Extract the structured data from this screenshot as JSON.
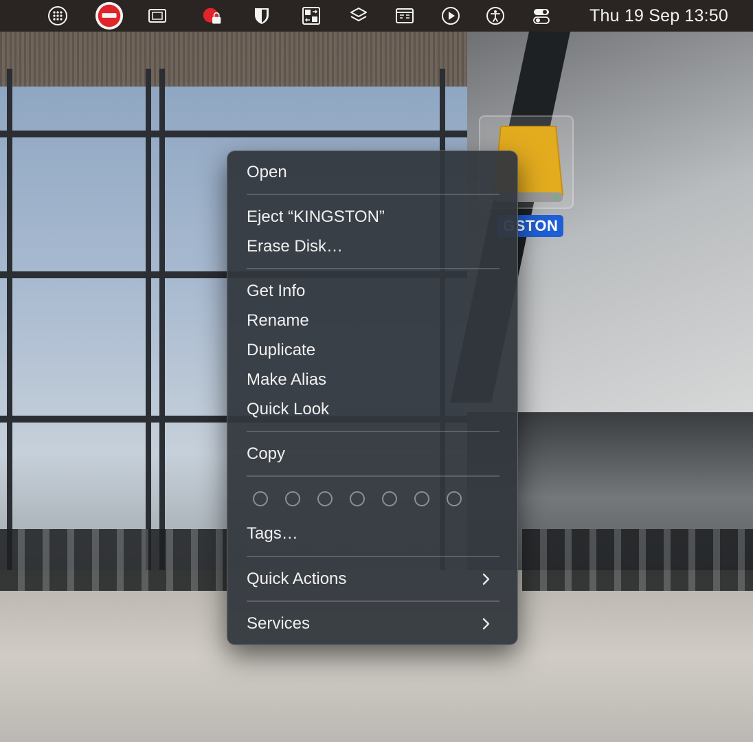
{
  "menubar": {
    "icons": [
      {
        "name": "launchpad-grid-icon"
      },
      {
        "name": "do-not-disturb-icon"
      },
      {
        "name": "window-manager-icon"
      },
      {
        "name": "privacy-lock-icon"
      },
      {
        "name": "shield-icon"
      },
      {
        "name": "screens-switch-icon"
      },
      {
        "name": "layers-icon"
      },
      {
        "name": "keyboard-shortcuts-icon"
      },
      {
        "name": "play-icon"
      },
      {
        "name": "accessibility-icon"
      },
      {
        "name": "control-center-icon"
      }
    ],
    "clock": "Thu 19 Sep  13:50"
  },
  "desktop": {
    "drive": {
      "label": "KINGSTON",
      "visible_label": "GSTON",
      "color": "#e3ac1f"
    }
  },
  "context_menu": {
    "items": {
      "open": "Open",
      "eject": "Eject “KINGSTON”",
      "erase": "Erase Disk…",
      "get_info": "Get Info",
      "rename": "Rename",
      "duplicate": "Duplicate",
      "make_alias": "Make Alias",
      "quick_look": "Quick Look",
      "copy": "Copy",
      "tags": "Tags…",
      "quick_actions": "Quick Actions",
      "services": "Services"
    },
    "tag_count": 7
  },
  "colors": {
    "menubar_bg": "#2a2522",
    "menu_bg": "#32373e",
    "selection_blue": "#1f5fd6",
    "do_not_disturb_red": "#e0242b"
  }
}
